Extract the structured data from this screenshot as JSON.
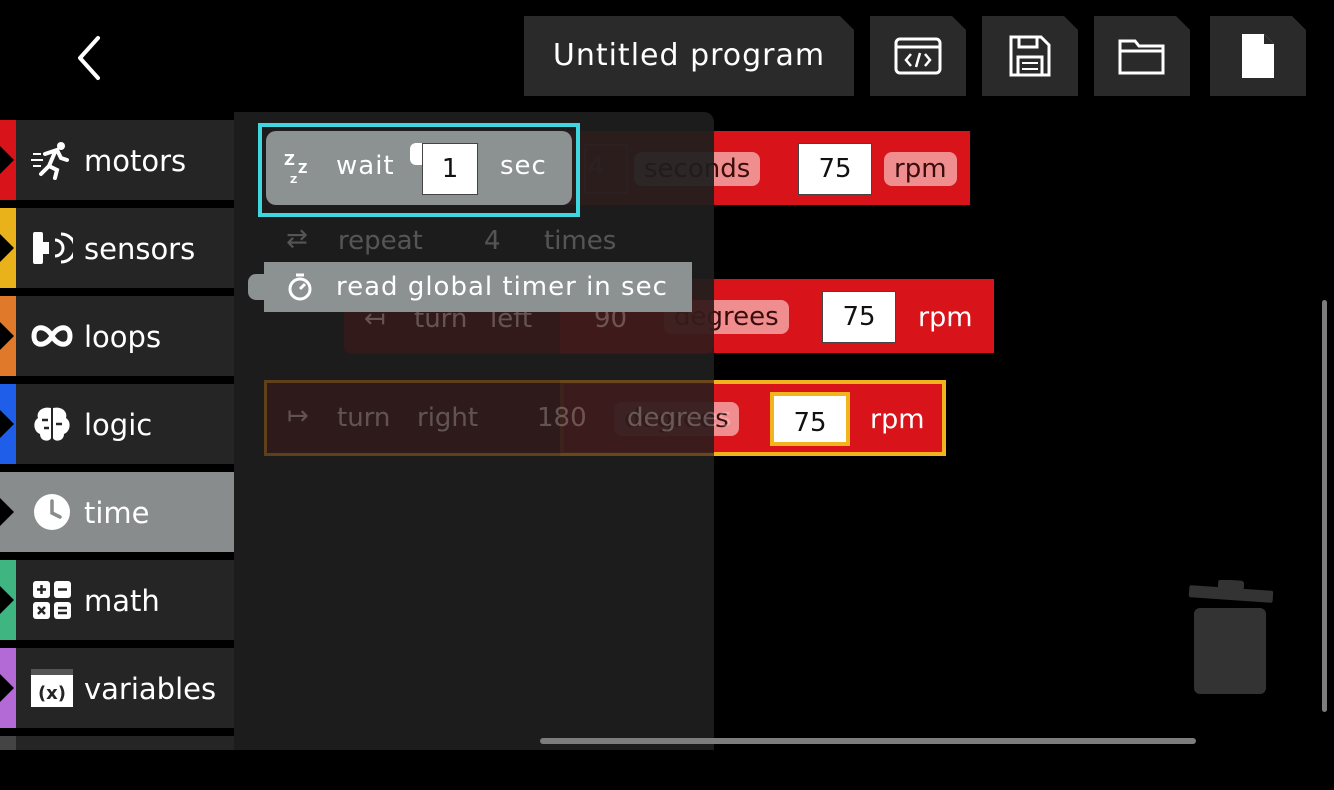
{
  "header": {
    "title": "Untitled program",
    "buttons": [
      "code-icon",
      "save-icon",
      "folder-icon",
      "new-file-icon"
    ]
  },
  "categories": [
    {
      "label": "motors",
      "color": "#d8141a",
      "icon": "running-person-icon"
    },
    {
      "label": "sensors",
      "color": "#e9b21b",
      "icon": "sensor-icon"
    },
    {
      "label": "loops",
      "color": "#e07a2a",
      "icon": "infinity-icon"
    },
    {
      "label": "logic",
      "color": "#1f5ee8",
      "icon": "brain-icon"
    },
    {
      "label": "time",
      "color": "#888c8c",
      "icon": "clock-icon",
      "active": true
    },
    {
      "label": "math",
      "color": "#3fb582",
      "icon": "calculator-icon"
    },
    {
      "label": "variables",
      "color": "#b46ad6",
      "icon": "variable-icon"
    }
  ],
  "palette": {
    "wait_block": {
      "label": "wait",
      "value": "1",
      "unit": "sec"
    },
    "timer_block": {
      "label": "read global timer in sec"
    }
  },
  "workspace": {
    "block1": {
      "value": "4",
      "unit": "seconds",
      "speed": "75",
      "speed_unit": "rpm"
    },
    "repeat": {
      "label": "repeat",
      "count": "4",
      "unit": "times"
    },
    "turn_left": {
      "label": "turn",
      "dir": "left",
      "value": "90",
      "unit": "degrees",
      "speed": "75",
      "speed_unit": "rpm"
    },
    "turn_right": {
      "label": "turn",
      "dir": "right",
      "value": "180",
      "unit": "degrees",
      "speed": "75",
      "speed_unit": "rpm"
    }
  }
}
